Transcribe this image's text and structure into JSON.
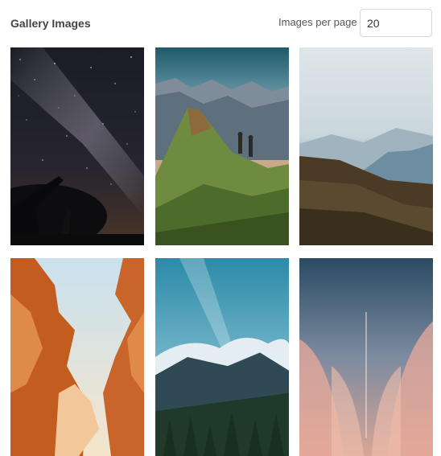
{
  "header": {
    "title": "Gallery Images",
    "per_page_label": "Images per page",
    "per_page_value": "20"
  },
  "gallery": {
    "images": [
      {
        "subject": "milky-way-telescope-night-sky"
      },
      {
        "subject": "hikers-mountain-ridge-sunset"
      },
      {
        "subject": "forested-hills-misty-valley"
      },
      {
        "subject": "orange-sandstone-slot-canyon"
      },
      {
        "subject": "cloud-covered-mountain-forest"
      },
      {
        "subject": "pink-wispy-clouds-sky"
      }
    ]
  }
}
